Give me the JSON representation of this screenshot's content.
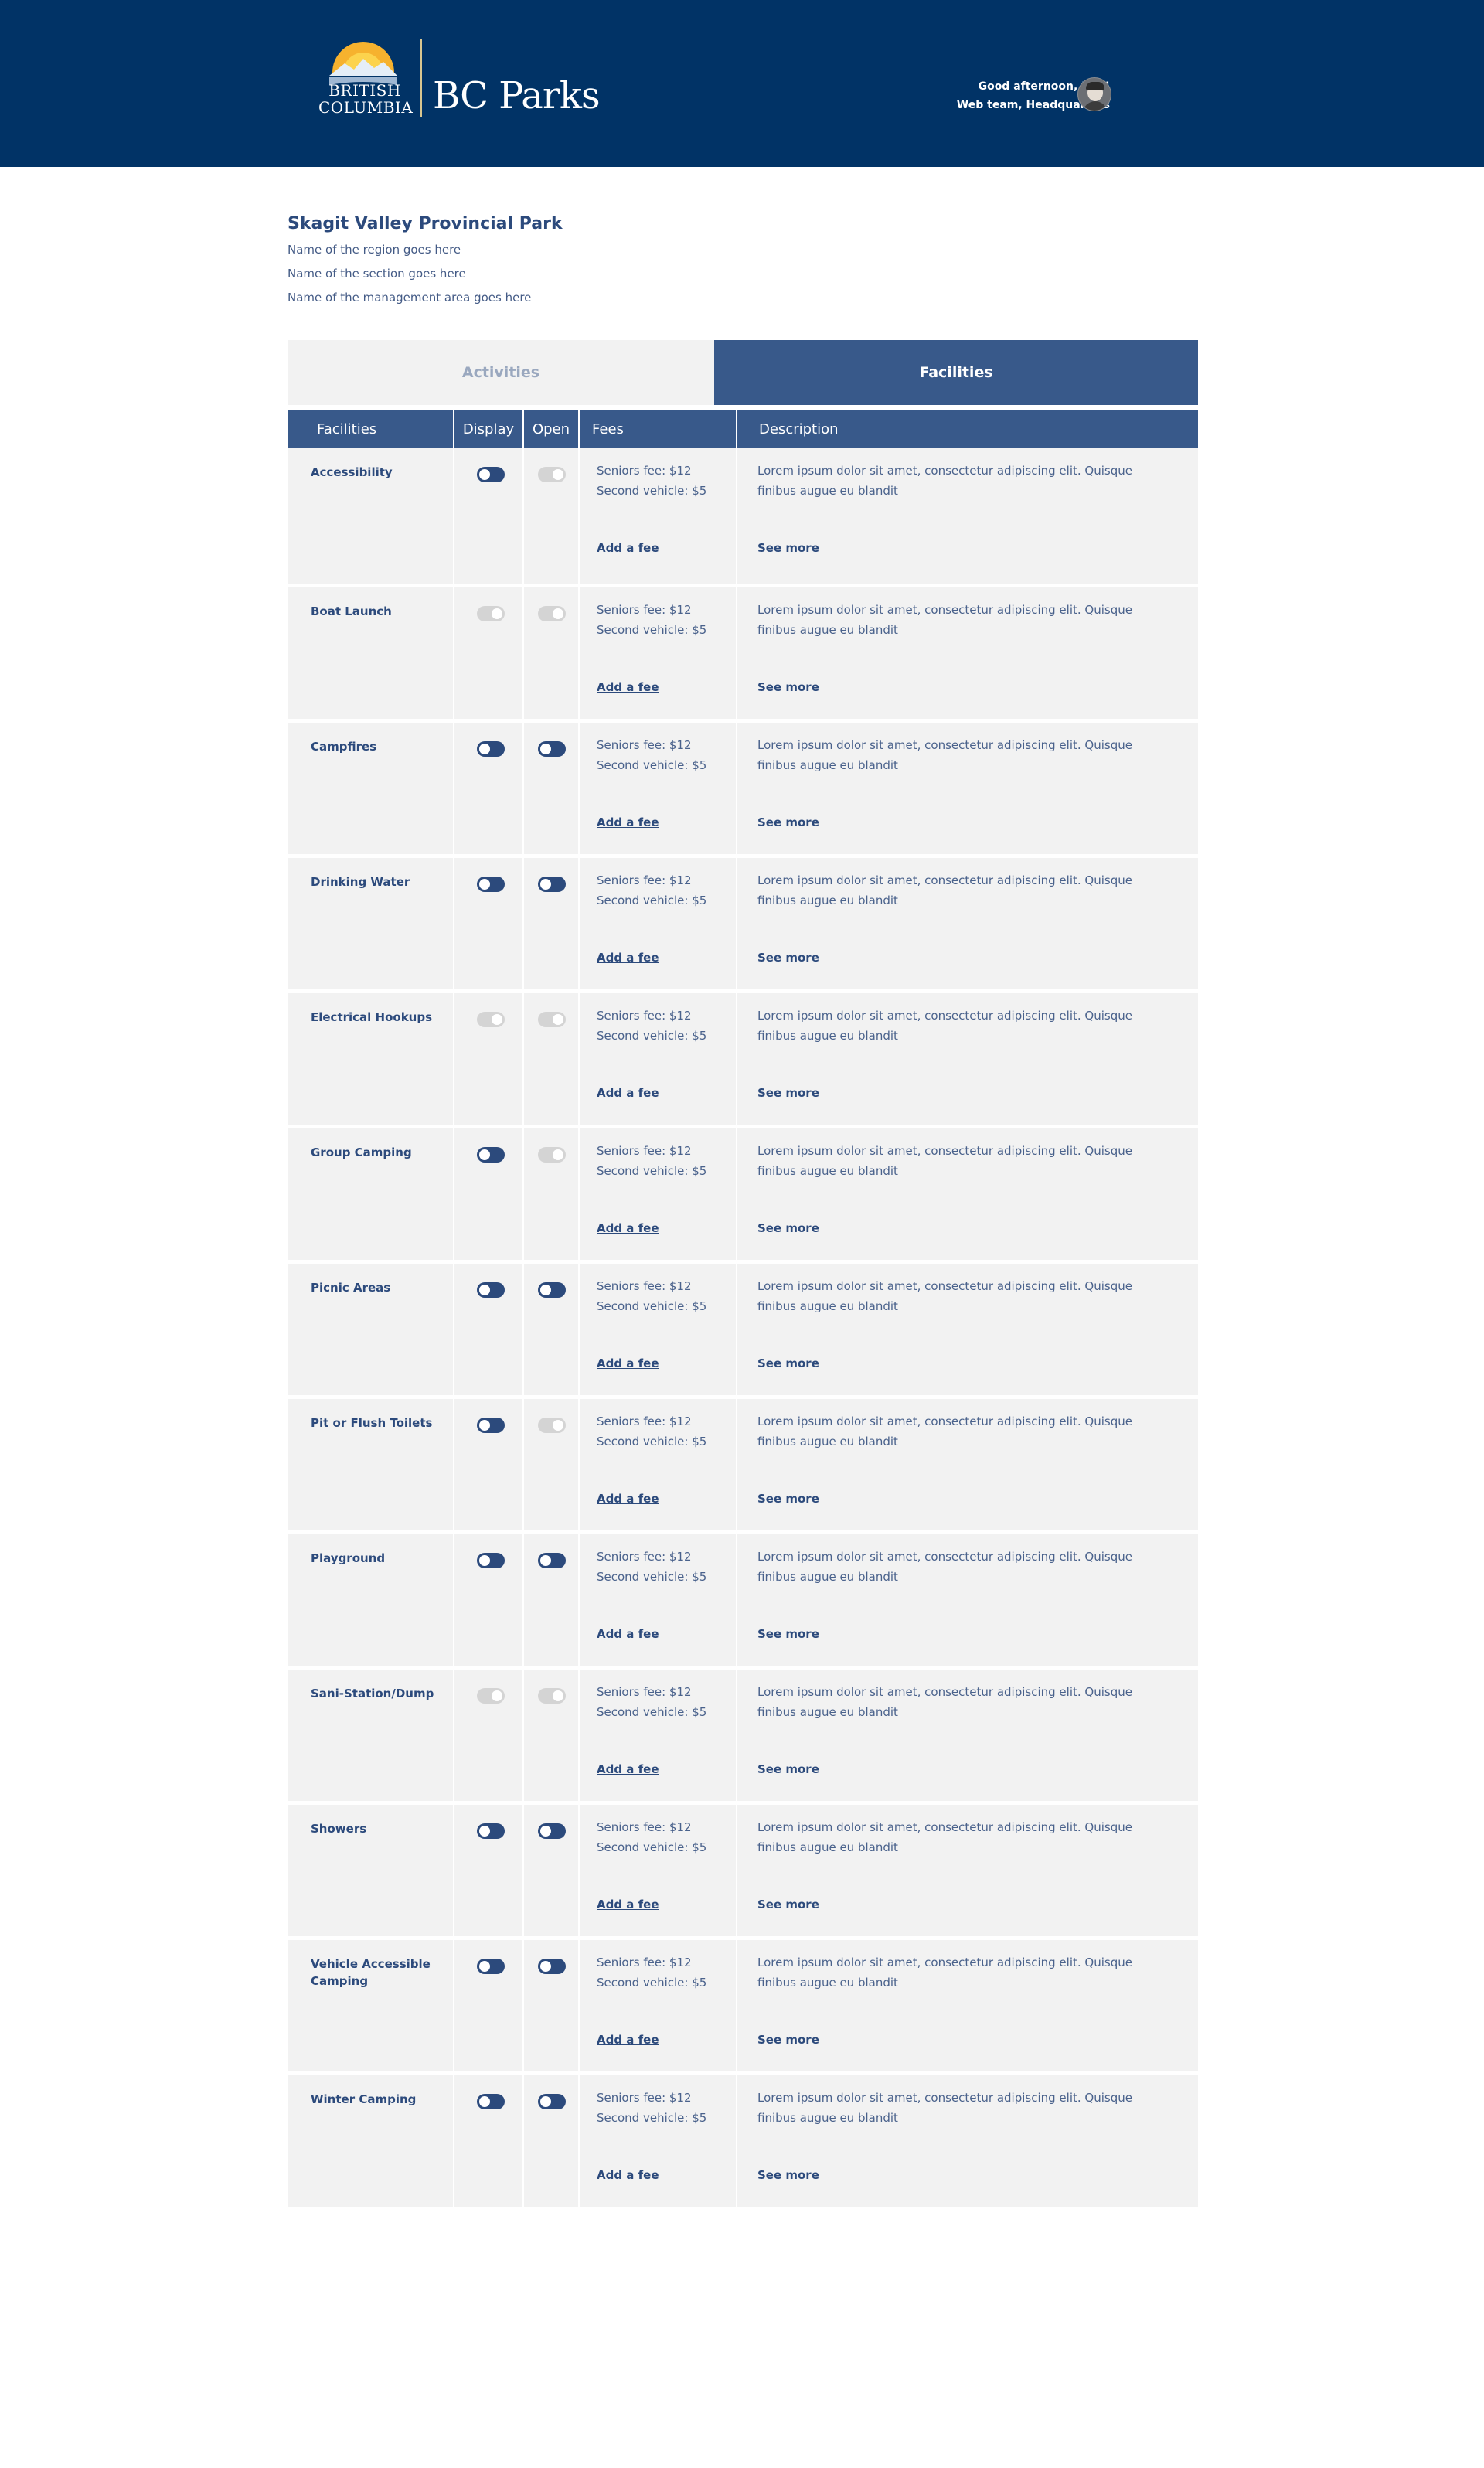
{
  "header": {
    "logo_bc_line1": "BRITISH",
    "logo_bc_line2": "COLUMBIA",
    "logo_brand": "BC Parks",
    "greeting": "Good afternoon, Rob!",
    "user_team": "Web team, Headquarters",
    "bg_color": "#013366"
  },
  "park": {
    "title": "Skagit Valley Provincial Park",
    "region": "Name of the region goes here",
    "section": "Name of the section goes here",
    "management_area": "Name of the management area goes here"
  },
  "tabs": {
    "activities": "Activities",
    "facilities": "Facilities",
    "active": "facilities"
  },
  "table": {
    "headers": {
      "facilities": "Facilities",
      "display": "Display",
      "open": "Open",
      "fees": "Fees",
      "description": "Description"
    },
    "rows": [
      {
        "name": "Accessibility",
        "display": true,
        "open": false,
        "fee1": "Seniors fee: $12",
        "fee2": "Second vehicle: $5",
        "add_fee": "Add a fee",
        "description": "Lorem ipsum dolor sit amet, consectetur adipiscing elit. Quisque finibus augue eu blandit",
        "see_more": "See more"
      },
      {
        "name": "Boat Launch",
        "display": false,
        "open": false,
        "fee1": "Seniors fee: $12",
        "fee2": "Second vehicle: $5",
        "add_fee": "Add a fee",
        "description": "Lorem ipsum dolor sit amet, consectetur adipiscing elit. Quisque finibus augue eu blandit",
        "see_more": "See more"
      },
      {
        "name": "Campfires",
        "display": true,
        "open": true,
        "fee1": "Seniors fee: $12",
        "fee2": "Second vehicle: $5",
        "add_fee": "Add a fee",
        "description": "Lorem ipsum dolor sit amet, consectetur adipiscing elit. Quisque finibus augue eu blandit",
        "see_more": "See more"
      },
      {
        "name": "Drinking Water",
        "display": true,
        "open": true,
        "fee1": "Seniors fee: $12",
        "fee2": "Second vehicle: $5",
        "add_fee": "Add a fee",
        "description": "Lorem ipsum dolor sit amet, consectetur adipiscing elit. Quisque finibus augue eu blandit",
        "see_more": "See more"
      },
      {
        "name": "Electrical Hookups",
        "display": false,
        "open": false,
        "fee1": "Seniors fee: $12",
        "fee2": "Second vehicle: $5",
        "add_fee": "Add a fee",
        "description": "Lorem ipsum dolor sit amet, consectetur adipiscing elit. Quisque finibus augue eu blandit",
        "see_more": "See more"
      },
      {
        "name": "Group Camping",
        "display": true,
        "open": false,
        "fee1": "Seniors fee: $12",
        "fee2": "Second vehicle: $5",
        "add_fee": "Add a fee",
        "description": "Lorem ipsum dolor sit amet, consectetur adipiscing elit. Quisque finibus augue eu blandit",
        "see_more": "See more"
      },
      {
        "name": "Picnic Areas",
        "display": true,
        "open": true,
        "fee1": "Seniors fee: $12",
        "fee2": "Second vehicle: $5",
        "add_fee": "Add a fee",
        "description": "Lorem ipsum dolor sit amet, consectetur adipiscing elit. Quisque finibus augue eu blandit",
        "see_more": "See more"
      },
      {
        "name": "Pit or Flush Toilets",
        "display": true,
        "open": false,
        "fee1": "Seniors fee: $12",
        "fee2": "Second vehicle: $5",
        "add_fee": "Add a fee",
        "description": "Lorem ipsum dolor sit amet, consectetur adipiscing elit. Quisque finibus augue eu blandit",
        "see_more": "See more"
      },
      {
        "name": "Playground",
        "display": true,
        "open": true,
        "fee1": "Seniors fee: $12",
        "fee2": "Second vehicle: $5",
        "add_fee": "Add a fee",
        "description": "Lorem ipsum dolor sit amet, consectetur adipiscing elit. Quisque finibus augue eu blandit",
        "see_more": "See more"
      },
      {
        "name": "Sani-Station/Dump",
        "display": false,
        "open": false,
        "fee1": "Seniors fee: $12",
        "fee2": "Second vehicle: $5",
        "add_fee": "Add a fee",
        "description": "Lorem ipsum dolor sit amet, consectetur adipiscing elit. Quisque finibus augue eu blandit",
        "see_more": "See more"
      },
      {
        "name": "Showers",
        "display": true,
        "open": true,
        "fee1": "Seniors fee: $12",
        "fee2": "Second vehicle: $5",
        "add_fee": "Add a fee",
        "description": "Lorem ipsum dolor sit amet, consectetur adipiscing elit. Quisque finibus augue eu blandit",
        "see_more": "See more"
      },
      {
        "name": "Vehicle Accessible Camping",
        "display": true,
        "open": true,
        "fee1": "Seniors fee: $12",
        "fee2": "Second vehicle: $5",
        "add_fee": "Add a fee",
        "description": "Lorem ipsum dolor sit amet, consectetur adipiscing elit. Quisque finibus augue eu blandit",
        "see_more": "See more"
      },
      {
        "name": "Winter Camping",
        "display": true,
        "open": true,
        "fee1": "Seniors fee: $12",
        "fee2": "Second vehicle: $5",
        "add_fee": "Add a fee",
        "description": "Lorem ipsum dolor sit amet, consectetur adipiscing elit. Quisque finibus augue eu blandit",
        "see_more": "See more"
      }
    ]
  },
  "colors": {
    "primary_blue": "#38598a",
    "text_blue": "#2c4a7c",
    "toggle_on": "#2c4a7c",
    "toggle_off": "#d4d4d4",
    "row_bg": "#f2f2f2",
    "logo_gold": "#f6b22e"
  }
}
